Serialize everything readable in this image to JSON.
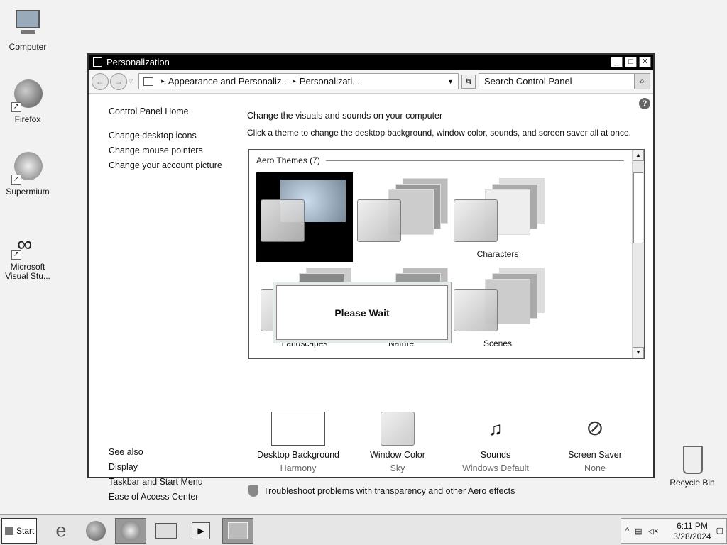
{
  "desktop": {
    "icons": [
      {
        "label": "Computer"
      },
      {
        "label": "Firefox"
      },
      {
        "label": "Supermium"
      },
      {
        "label": "Microsoft Visual Stu..."
      },
      {
        "label": "Recycle Bin"
      }
    ]
  },
  "window": {
    "title": "Personalization",
    "controls": {
      "minimize": "_",
      "maximize": "□",
      "close": "✕"
    },
    "nav": {
      "breadcrumb": [
        "Appearance and Personaliz...",
        "Personalizati..."
      ],
      "search_placeholder": "Search Control Panel"
    },
    "left_pane": {
      "home": "Control Panel Home",
      "links": [
        "Change desktop icons",
        "Change mouse pointers",
        "Change your account picture"
      ],
      "see_also_title": "See also",
      "see_also": [
        "Display",
        "Taskbar and Start Menu",
        "Ease of Access Center"
      ]
    },
    "main": {
      "title": "Change the visuals and sounds on your computer",
      "description": "Click a theme to change the desktop background, window color, sounds, and screen saver all at once.",
      "group_header": "Aero Themes (7)",
      "themes": [
        {
          "label": ""
        },
        {
          "label": ""
        },
        {
          "label": "Characters"
        },
        {
          "label": "Landscapes"
        },
        {
          "label": "Nature"
        },
        {
          "label": "Scenes"
        }
      ],
      "dialog_text": "Please Wait",
      "settings": [
        {
          "name": "Desktop Background",
          "value": "Harmony"
        },
        {
          "name": "Window Color",
          "value": "Sky"
        },
        {
          "name": "Sounds",
          "value": "Windows Default"
        },
        {
          "name": "Screen Saver",
          "value": "None"
        }
      ],
      "troubleshoot": "Troubleshoot problems with transparency and other Aero effects"
    }
  },
  "taskbar": {
    "start_label": "Start",
    "clock_time": "6:11 PM",
    "clock_date": "3/28/2024"
  }
}
